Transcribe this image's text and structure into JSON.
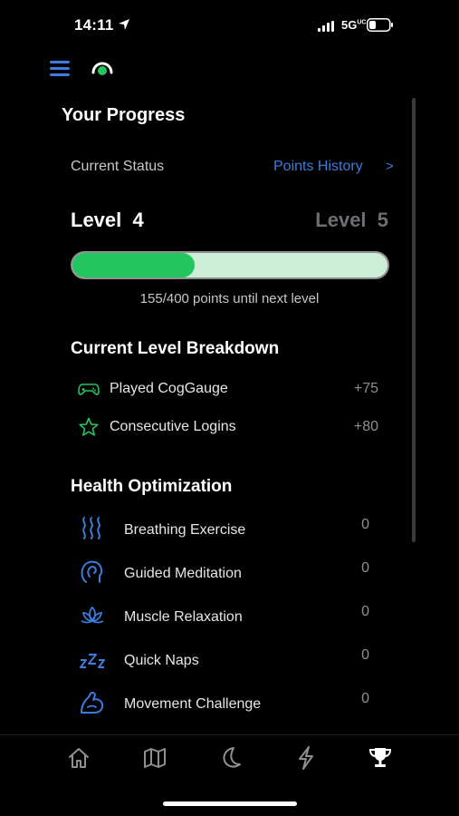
{
  "status_bar": {
    "time": "14:11",
    "network": "5G",
    "network_sup": "UC"
  },
  "header": {
    "title": "Your Progress"
  },
  "status": {
    "label": "Current Status",
    "points_history_label": "Points History",
    "chevron": ">"
  },
  "level": {
    "current_label": "Level  4",
    "next_label": "Level  5",
    "progress_fraction": 0.3875,
    "progress_text": "155/400 points until next level"
  },
  "breakdown": {
    "title": "Current Level Breakdown",
    "items": [
      {
        "label": "Played CogGauge",
        "points": "+75",
        "icon": "gamepad-icon"
      },
      {
        "label": "Consecutive Logins",
        "points": "+80",
        "icon": "star-icon"
      }
    ]
  },
  "health": {
    "title": "Health Optimization",
    "items": [
      {
        "label": "Breathing Exercise",
        "value": "0",
        "icon": "breathing-waves-icon"
      },
      {
        "label": "Guided Meditation",
        "value": "0",
        "icon": "meditation-head-icon"
      },
      {
        "label": "Muscle Relaxation",
        "value": "0",
        "icon": "lotus-icon"
      },
      {
        "label": "Quick Naps",
        "value": "0",
        "icon": "zzz-icon"
      },
      {
        "label": "Movement Challenge",
        "value": "0",
        "icon": "flexed-arm-icon"
      }
    ]
  },
  "tabs": [
    {
      "name": "home",
      "icon": "home-icon",
      "active": false
    },
    {
      "name": "map",
      "icon": "map-icon",
      "active": false
    },
    {
      "name": "sleep",
      "icon": "moon-icon",
      "active": false
    },
    {
      "name": "energy",
      "icon": "lightning-icon",
      "active": false
    },
    {
      "name": "progress",
      "icon": "trophy-icon",
      "active": true
    }
  ],
  "colors": {
    "background": "#000000",
    "accent_blue": "#3b7ddd",
    "progress_fill": "#22c55e",
    "progress_track": "#cdeed6",
    "icon_green": "#22c55e"
  }
}
